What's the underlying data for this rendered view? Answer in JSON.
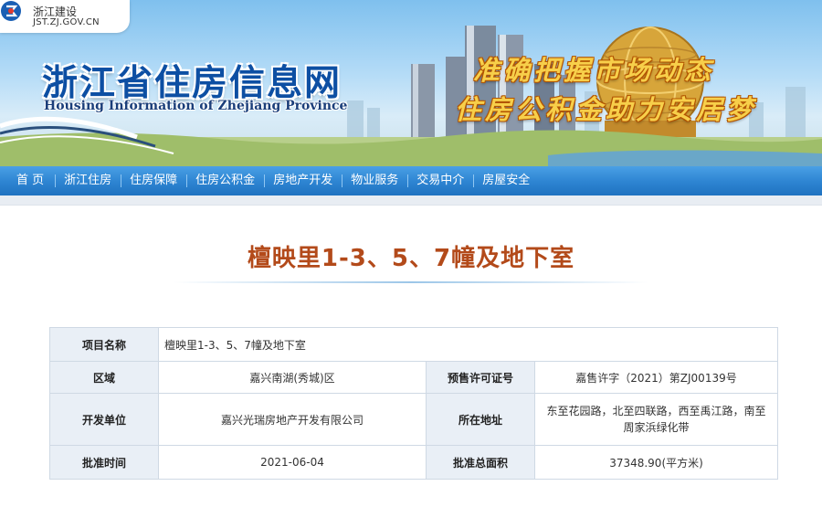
{
  "header": {
    "logo_cn": "浙江建设",
    "logo_en": "JST.ZJ.GOV.CN",
    "site_title": "浙江省住房信息网",
    "site_subtitle": "Housing Information of Zhejiang Province",
    "slogan_1": "准确把握市场动态",
    "slogan_2": "住房公积金助力安居梦"
  },
  "nav": {
    "items": [
      "首 页",
      "浙江住房",
      "住房保障",
      "住房公积金",
      "房地产开发",
      "物业服务",
      "交易中介",
      "房屋安全"
    ]
  },
  "page": {
    "title": "檀映里1-3、5、7幢及地下室"
  },
  "project": {
    "name_label": "项目名称",
    "name_value": "檀映里1-3、5、7幢及地下室",
    "region_label": "区域",
    "region_value": "嘉兴南湖(秀城)区",
    "permit_label": "预售许可证号",
    "permit_value": "嘉售许字（2021）第ZJ00139号",
    "developer_label": "开发单位",
    "developer_value": "嘉兴光瑞房地产开发有限公司",
    "address_label": "所在地址",
    "address_value": "东至花园路，北至四联路，西至禹江路，南至周家浜绿化带",
    "approval_time_label": "批准时间",
    "approval_time_value": "2021-06-04",
    "approved_area_label": "批准总面积",
    "approved_area_value": "37348.90(平方米)"
  },
  "colors": {
    "nav_blue": "#2f86d3",
    "title_brown": "#b34a1a",
    "brand_blue": "#0d4fa3",
    "slogan_gold": "#f7cf4a"
  }
}
